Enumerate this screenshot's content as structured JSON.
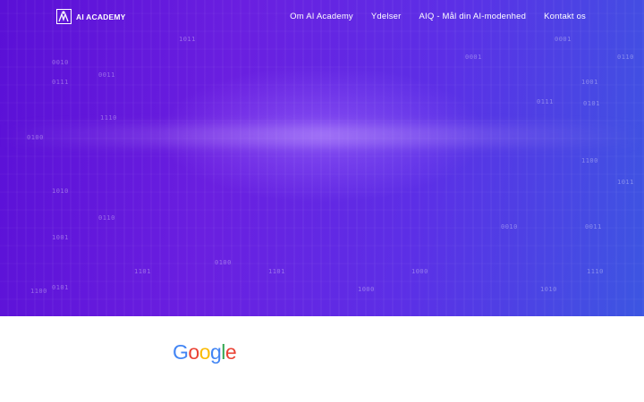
{
  "header": {
    "logo_text": "AI ACADEMY",
    "logo_icon": "ai-academy-logo-icon"
  },
  "nav": {
    "items": [
      {
        "label": "Om AI Academy"
      },
      {
        "label": "Ydelser"
      },
      {
        "label": "AIQ - Mål din AI-modenhed"
      },
      {
        "label": "Kontakt os"
      }
    ]
  },
  "hero": {
    "background_colors": [
      "#5a10d6",
      "#6a1fe0",
      "#3c56e2"
    ]
  },
  "partner_logo": {
    "letters": [
      "G",
      "o",
      "o",
      "g",
      "l",
      "e"
    ],
    "colors": [
      "#4285F4",
      "#EA4335",
      "#FBBC05",
      "#4285F4",
      "#34A853",
      "#EA4335"
    ]
  },
  "decor_digits": [
    "0010",
    "0111",
    "1010",
    "1001",
    "0101",
    "1100",
    "0011",
    "1110",
    "0110",
    "1011",
    "0100",
    "1101",
    "1000",
    "0001"
  ]
}
